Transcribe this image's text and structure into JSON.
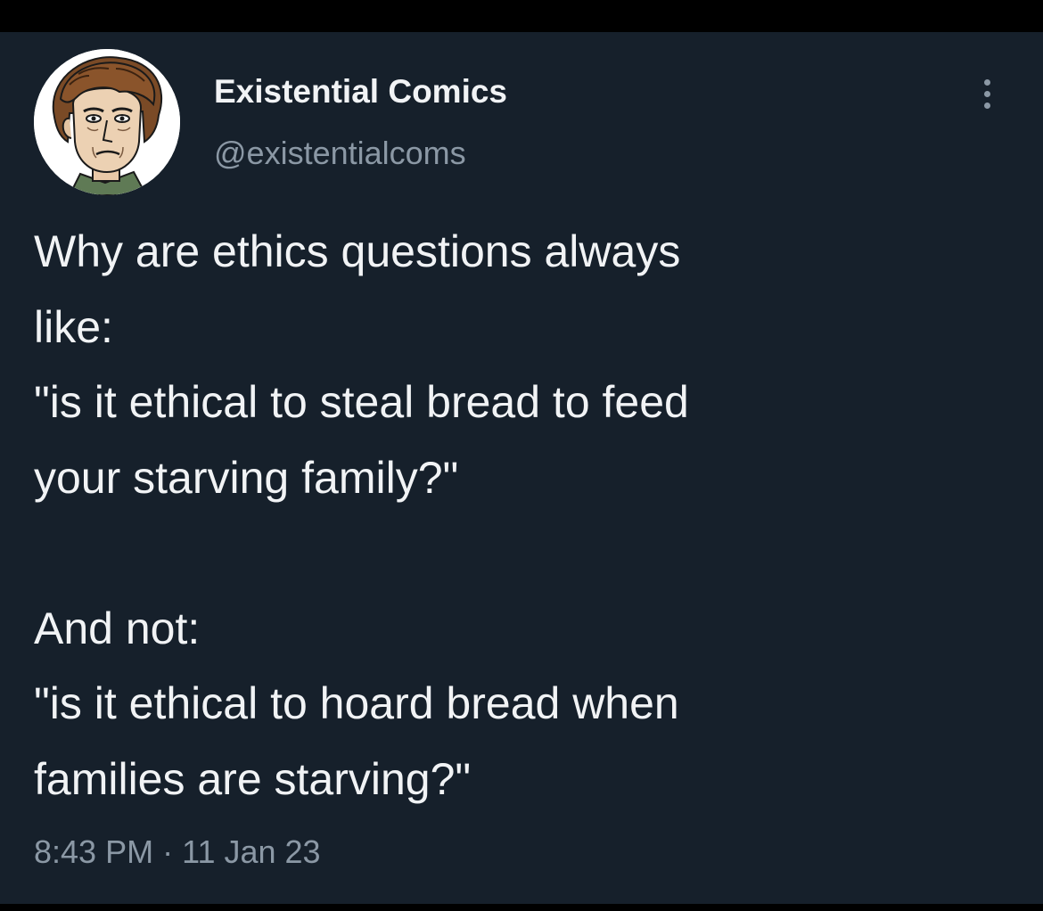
{
  "author": {
    "display_name": "Existential Comics",
    "handle": "@existentialcoms",
    "avatar_icon": "cartoon-portrait-avatar"
  },
  "tweet": {
    "lines": [
      "Why are ethics questions always",
      "like:",
      "\"is it ethical to steal bread to feed",
      "your starving family?\"",
      "",
      "And not:",
      "\"is it ethical to hoard bread when",
      "families are starving?\""
    ],
    "time": "8:43 PM",
    "separator": "·",
    "date": "11 Jan 23"
  },
  "menu": {
    "icon": "more-options-icon"
  },
  "colors": {
    "background": "#16202b",
    "primary_text": "#f1f3f5",
    "secondary_text": "#8b98a5"
  }
}
